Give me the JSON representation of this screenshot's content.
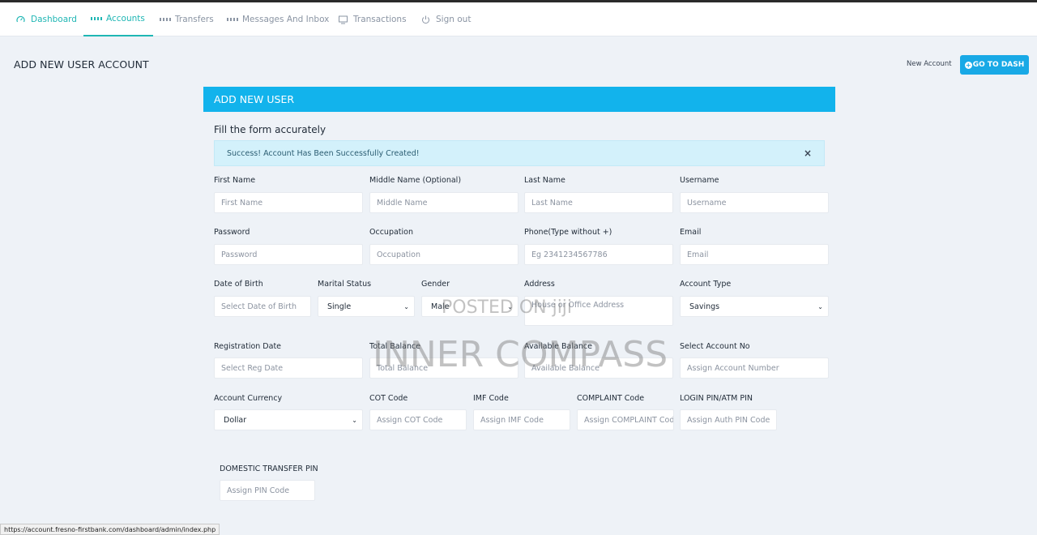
{
  "nav": {
    "items": [
      {
        "label": "Dashboard",
        "icon": "gauge-icon"
      },
      {
        "label": "Accounts",
        "icon": "grid-icon"
      },
      {
        "label": "Transfers",
        "icon": "grid-icon"
      },
      {
        "label": "Messages And Inbox",
        "icon": "grid-icon"
      },
      {
        "label": "Transactions",
        "icon": "monitor-icon"
      },
      {
        "label": "Sign out",
        "icon": "power-icon"
      }
    ]
  },
  "page": {
    "title": "ADD NEW USER ACCOUNT",
    "breadcrumb": "New Account",
    "dash_button": "GO TO DASH"
  },
  "card": {
    "header": "ADD NEW USER",
    "subtitle": "Fill the form accurately",
    "alert": "Success! Account Has Been Successfully Created!",
    "alert_close": "×"
  },
  "form": {
    "first_name": {
      "label": "First Name",
      "placeholder": "First Name"
    },
    "middle_name": {
      "label": "Middle Name (Optional)",
      "placeholder": "Middle Name"
    },
    "last_name": {
      "label": "Last Name",
      "placeholder": "Last Name"
    },
    "username": {
      "label": "Username",
      "placeholder": "Username"
    },
    "password": {
      "label": "Password",
      "placeholder": "Password"
    },
    "occupation": {
      "label": "Occupation",
      "placeholder": "Occupation"
    },
    "phone": {
      "label": "Phone(Type without +)",
      "placeholder": "Eg 2341234567786"
    },
    "email": {
      "label": "Email",
      "placeholder": "Email"
    },
    "dob": {
      "label": "Date of Birth",
      "placeholder": "Select Date of Birth"
    },
    "marital": {
      "label": "Marital Status",
      "value": "Single"
    },
    "gender": {
      "label": "Gender",
      "value": "Male"
    },
    "address": {
      "label": "Address",
      "placeholder": "House or Office Address"
    },
    "account_type": {
      "label": "Account Type",
      "value": "Savings"
    },
    "reg_date": {
      "label": "Registration Date",
      "placeholder": "Select Reg Date"
    },
    "total_balance": {
      "label": "Total Balance",
      "placeholder": "Total Balance"
    },
    "available_balance": {
      "label": "Available Balance",
      "placeholder": "Available Balance"
    },
    "account_no": {
      "label": "Select Account No",
      "placeholder": "Assign Account Number"
    },
    "currency": {
      "label": "Account Currency",
      "value": "Dollar"
    },
    "cot": {
      "label": "COT Code",
      "placeholder": "Assign COT Code"
    },
    "imf": {
      "label": "IMF Code",
      "placeholder": "Assign IMF Code"
    },
    "complaint": {
      "label": "COMPLAINT Code",
      "placeholder": "Assign COMPLAINT Code"
    },
    "login_pin": {
      "label": "LOGIN PIN/ATM PIN",
      "placeholder": "Assign Auth PIN Code"
    },
    "domestic_pin": {
      "label": "DOMESTIC TRANSFER PIN",
      "placeholder": "Assign PIN Code"
    }
  },
  "watermark": {
    "line1": "POSTED ON jiji",
    "line2": "INNER COMPASS"
  },
  "status_url": "https://account.fresno-firstbank.com/dashboard/admin/index.php",
  "colors": {
    "accent": "#12b3ec",
    "teal": "#1fb6b4",
    "button": "#18a9e6"
  }
}
